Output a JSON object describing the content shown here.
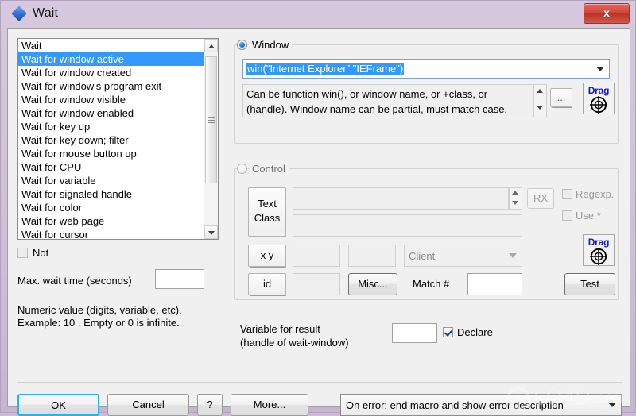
{
  "window": {
    "title": "Wait",
    "icon": "blue-diamond-icon",
    "close_label": "x",
    "titlebar_color": "#cbbcd4"
  },
  "command_list": {
    "items": [
      "Wait",
      "Wait for window active",
      "Wait for window created",
      "Wait for window's program exit",
      "Wait for window visible",
      "Wait for window enabled",
      "Wait for key up",
      "Wait for key down; filter",
      "Wait for mouse button up",
      "Wait for CPU",
      "Wait for variable",
      "Wait for signaled handle",
      "Wait for color",
      "Wait for web page",
      "Wait for cursor"
    ],
    "selected_index": 1,
    "selection_color": "#3399ff"
  },
  "not_checkbox": {
    "label": "Not",
    "checked": false
  },
  "max_wait": {
    "label": "Max. wait time (seconds)",
    "value": "",
    "hint_line1": "Numeric value (digits, variable, etc).",
    "hint_line2": "Example: 10 . Empty or 0 is infinite."
  },
  "window_group": {
    "title": "Window",
    "radio_selected": true,
    "combo_value": "win(\"Internet Explorer\" \"IEFrame\")",
    "info_line1": "Can be function win(), or window name, or +class, or",
    "info_line2": "(handle). Window name can be partial, must match case.",
    "browse_label": "...",
    "drag_label": "Drag"
  },
  "control_group": {
    "title": "Control",
    "radio_selected": false,
    "text_class_line1": "Text",
    "text_class_line2": "Class",
    "text_value": "",
    "class_value": "",
    "rx_label": "RX",
    "regexp_label": "Regexp.",
    "regexp_checked": false,
    "use_star_label": "Use *",
    "use_star_checked": false,
    "xy_label": "x y",
    "x_value": "",
    "y_value": "",
    "coord_mode": "Client",
    "id_label": "id",
    "id_value": "",
    "misc_label": "Misc...",
    "match_label": "Match #",
    "match_value": "",
    "drag_label": "Drag",
    "test_label": "Test"
  },
  "result": {
    "label_line1": "Variable for result",
    "label_line2": "(handle of wait-window)",
    "value": "",
    "declare_label": "Declare",
    "declare_checked": true
  },
  "footer": {
    "ok_label": "OK",
    "cancel_label": "Cancel",
    "help_label": "?",
    "more_label": "More...",
    "on_error": "On error: end macro and show error description"
  },
  "watermark": {
    "text": "LO4D",
    "suffix": ".com"
  }
}
